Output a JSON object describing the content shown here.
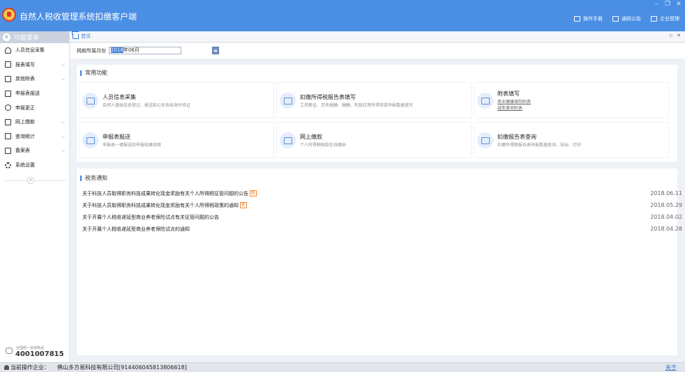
{
  "window": {
    "title": "自然人税收管理系统扣缴客户端",
    "controls": [
      "–",
      "❐",
      "✕"
    ],
    "header_links": [
      {
        "label": "操作手册",
        "icon": "manual-icon"
      },
      {
        "label": "通知公告",
        "icon": "mail-icon"
      },
      {
        "label": "企业管理",
        "icon": "building-icon"
      }
    ]
  },
  "sidebar": {
    "title": "功能菜单",
    "items": [
      {
        "label": "人员信息采集",
        "icon": "user-icon",
        "expandable": false
      },
      {
        "label": "报表填写",
        "icon": "form-icon",
        "expandable": true
      },
      {
        "label": "其他附表",
        "icon": "attachment-icon",
        "expandable": true
      },
      {
        "label": "申报表报送",
        "icon": "grid-icon",
        "expandable": false
      },
      {
        "label": "申报更正",
        "icon": "search-icon",
        "expandable": false
      },
      {
        "label": "网上缴款",
        "icon": "payment-icon",
        "expandable": true
      },
      {
        "label": "查询统计",
        "icon": "stats-icon",
        "expandable": true
      },
      {
        "label": "备案表",
        "icon": "archive-icon",
        "expandable": true
      },
      {
        "label": "系统设置",
        "icon": "gear-icon",
        "expandable": false
      }
    ],
    "collapse_symbol": "«",
    "hotline_label": "全国统一咨询电话",
    "hotline_number": "4001007815"
  },
  "tabs": {
    "home_label": "首页",
    "controls": [
      "▫",
      "✕"
    ]
  },
  "period": {
    "label": "税款所属月份",
    "year": "2018",
    "month": "年06月"
  },
  "common_functions": {
    "title": "常用功能",
    "cards": [
      {
        "title": "人员信息采集",
        "desc": "自然人基础信息登记、报送和公安系统身份验证",
        "icon": "id-card-icon"
      },
      {
        "title": "扣缴所得税报告表填写",
        "desc": "工资薪金、劳务报酬、稿酬、利息红等所得项目申报数据填写",
        "icon": "report-form-icon"
      },
      {
        "title": "附表填写",
        "desc": "",
        "icon": "edit-icon",
        "links": [
          "商业健康保险附表",
          "减免事项附表"
        ]
      },
      {
        "title": "申报表报送",
        "desc": "申报表一键报送和申报结果获取",
        "icon": "submit-icon"
      },
      {
        "title": "网上缴款",
        "desc": "个人所得税税款在线缴纳",
        "icon": "online-pay-icon"
      },
      {
        "title": "扣缴报告表查询",
        "desc": "扣缴所得税报告表申报数据查询、导出、打印",
        "icon": "query-icon"
      }
    ]
  },
  "notices": {
    "title": "税务通知",
    "new_label": "新",
    "items": [
      {
        "text": "关于科技人员取得职务科技成果转化现金奖励有关个人所得税征管问题的公告",
        "date": "2018.06.11",
        "is_new": true
      },
      {
        "text": "关于科技人员取得职务科技成果转化现金奖励有关个人所得税政策的通知",
        "date": "2018.05.29",
        "is_new": true
      },
      {
        "text": "关于开展个人税收递延型商业养老保险试点有关征管问题的公告",
        "date": "2018.04.02",
        "is_new": false
      },
      {
        "text": "关于开展个人税收递延型商业养老保险试点的通知",
        "date": "2018.04.28",
        "is_new": false
      }
    ]
  },
  "statusbar": {
    "label": "当前操作企业：",
    "company": "佛山多方易科技有限公司[914406045813806618]",
    "about": "关于"
  }
}
